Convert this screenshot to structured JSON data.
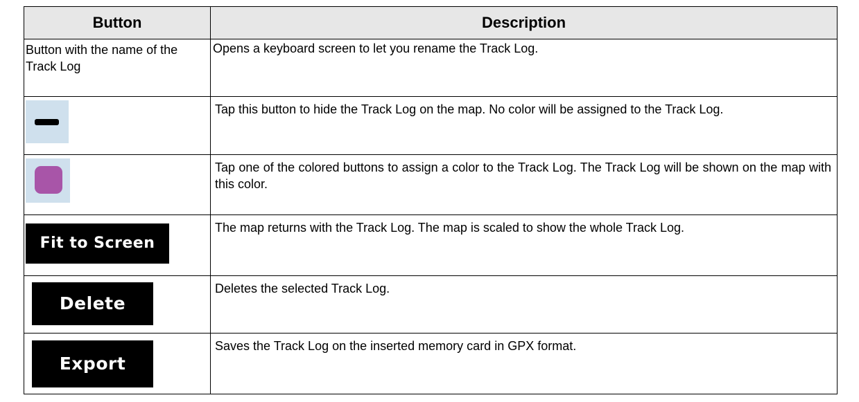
{
  "table": {
    "headers": {
      "button": "Button",
      "description": "Description"
    },
    "rows": [
      {
        "button_text": "Button with the name of the Track Log",
        "description": "Opens a keyboard screen to let you rename the Track Log."
      },
      {
        "button_icon": "minus-icon",
        "description": "Tap this button to hide the Track Log on the map. No color will be assigned to the Track Log."
      },
      {
        "button_icon": "color-swatch-icon",
        "swatch_color": "#a855a8",
        "description": "Tap one of the colored buttons to assign a color to the Track Log. The Track Log will be shown on the map with this color."
      },
      {
        "button_label": "Fit to Screen",
        "description": "The map returns with the Track Log. The map is scaled to show the whole Track Log."
      },
      {
        "button_label": "Delete",
        "description": "Deletes the selected Track Log."
      },
      {
        "button_label": "Export",
        "description": "Saves the Track Log on the inserted memory card in GPX format."
      }
    ]
  },
  "colors": {
    "header_bg": "#e7e7e7",
    "icon_button_bg": "#cfe0ed",
    "label_button_bg": "#000000",
    "label_button_text": "#ffffff"
  }
}
